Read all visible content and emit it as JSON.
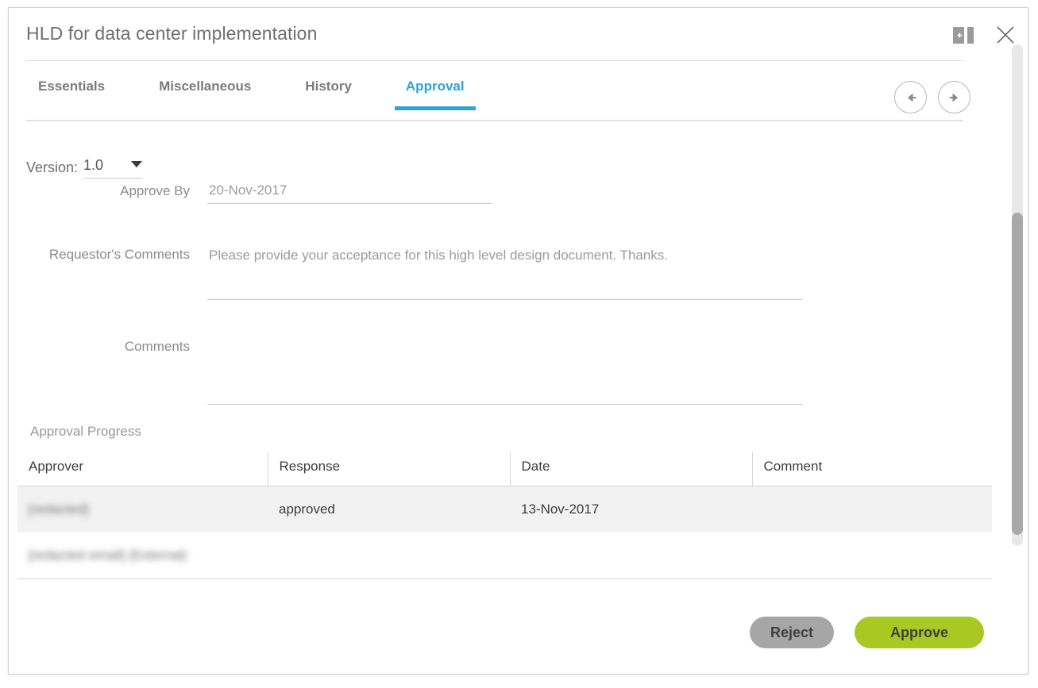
{
  "dialog": {
    "title": "HLD for data center implementation",
    "panel_toggle_icon": "collapse-panel-icon",
    "close_icon": "close-icon"
  },
  "tabs": [
    {
      "label": "Essentials",
      "active": false
    },
    {
      "label": "Miscellaneous",
      "active": false
    },
    {
      "label": "History",
      "active": false
    },
    {
      "label": "Approval",
      "active": true
    }
  ],
  "nav": {
    "prev_icon": "arrow-left-icon",
    "next_icon": "arrow-right-icon"
  },
  "version": {
    "label": "Version:",
    "value": "1.0",
    "caret_icon": "chevron-down-icon"
  },
  "fields": {
    "approve_by": {
      "label": "Approve By",
      "value": "20-Nov-2017",
      "placeholder": ""
    },
    "requestor_comments": {
      "label": "Requestor's Comments",
      "value": "Please provide your acceptance for this high level design document. Thanks.",
      "placeholder": ""
    },
    "comments": {
      "label": "Comments",
      "value": "",
      "placeholder": ""
    }
  },
  "approval_progress": {
    "section_label": "Approval Progress",
    "columns": [
      "Approver",
      "Response",
      "Date",
      "Comment"
    ],
    "rows": [
      {
        "approver": "[redacted]",
        "approver_redacted": true,
        "response": "approved",
        "date": "13-Nov-2017",
        "comment": ""
      },
      {
        "approver": "[redacted email] (External)",
        "approver_redacted": true,
        "response": "",
        "date": "",
        "comment": ""
      }
    ]
  },
  "footer": {
    "reject_label": "Reject",
    "approve_label": "Approve"
  },
  "colors": {
    "accent_blue": "#2da3dd",
    "approve_green": "#aac722",
    "reject_gray": "#a6a6a6",
    "title_gray": "#6f6f6f",
    "row_shade": "#f2f2f2"
  }
}
